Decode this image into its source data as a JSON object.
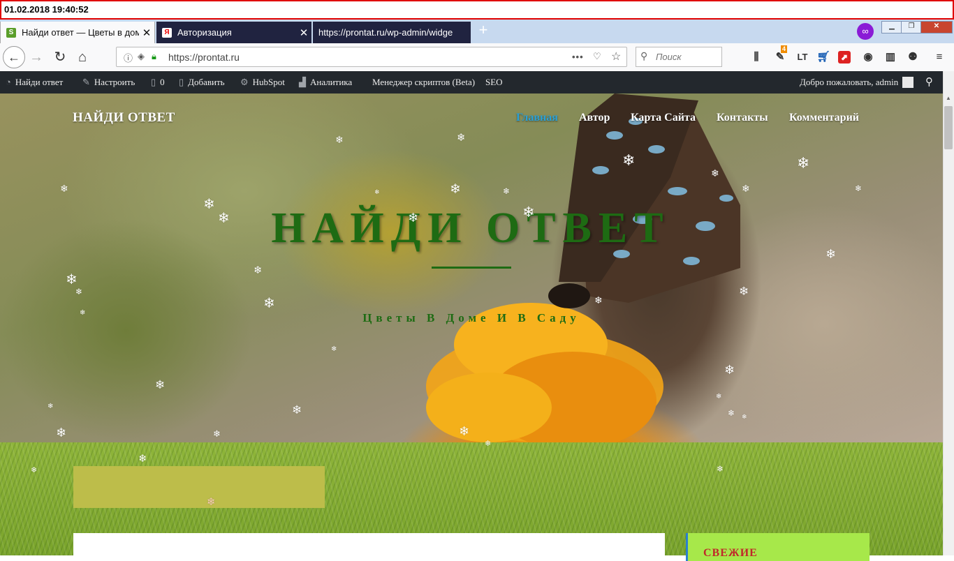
{
  "timestamp": "01.02.2018 19:40:52",
  "tabs": [
    {
      "title": "Найди ответ — Цветы в доме",
      "favicon": "S"
    },
    {
      "title": "Авторизация",
      "favicon": "Я"
    },
    {
      "title": "https://prontat.ru/wp-admin/widge"
    }
  ],
  "window_buttons": {
    "min": "▁",
    "max": "❐",
    "close": "✕"
  },
  "url": "https://prontat.ru",
  "search_placeholder": "Поиск",
  "nav_icons": {
    "back": "←",
    "forward": "→",
    "reload": "↻",
    "home": "⌂",
    "more": "•••",
    "pocket": "♡",
    "star": "☆"
  },
  "toolbar": {
    "badge": "4",
    "lt": "LT"
  },
  "wpbar": {
    "items": [
      "Найди ответ",
      "Настроить",
      "0",
      "Добавить",
      "HubSpot",
      "Аналитика",
      "Менеджер скриптов (Beta)",
      "SEO"
    ],
    "welcome": "Добро пожаловать, admin"
  },
  "site": {
    "name": "НАЙДИ ОТВЕТ",
    "menu": [
      "Главная",
      "Автор",
      "Карта Сайта",
      "Контакты",
      "Комментарий"
    ],
    "hero_title": "НАЙДИ ОТВЕТ",
    "tagline": "Цветы В Доме И В Саду",
    "sidebar_heading": "СВЕЖИЕ"
  },
  "colors": {
    "accent_menu": "#2aa0d6",
    "title_green": "#1e6b13",
    "sidebar_bg": "#a7e84a",
    "sidebar_heading": "#c0282a"
  }
}
